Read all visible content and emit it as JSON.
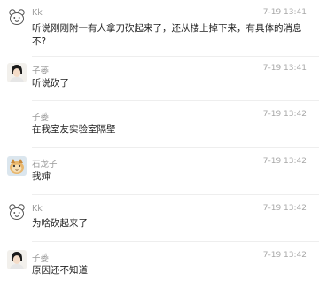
{
  "messages": [
    {
      "sender": "Kk",
      "time": "7-19 13:41",
      "text": "听说刚刚附一有人拿刀砍起来了，还从楼上掉下来，有具体的消息不?",
      "avatar_icon": "bear-doodle-icon"
    },
    {
      "sender": "子蒌",
      "time": "7-19 13:41",
      "text": "听说砍了",
      "avatar_icon": "person-portrait-icon"
    },
    {
      "sender": "子蒌",
      "time": "7-19 13:42",
      "text": "在我室友实验室隔壁",
      "avatar_icon": ""
    },
    {
      "sender": "石龙子",
      "time": "7-19 13:42",
      "text": "我婶",
      "avatar_icon": "cartoon-creature-icon"
    },
    {
      "sender": "Kk",
      "time": "7-19 13:42",
      "text": "为啥砍起来了",
      "avatar_icon": "bear-doodle-icon"
    },
    {
      "sender": "子蒌",
      "time": "7-19 13:42",
      "text": "原因还不知道",
      "avatar_icon": "person-portrait-icon"
    }
  ]
}
